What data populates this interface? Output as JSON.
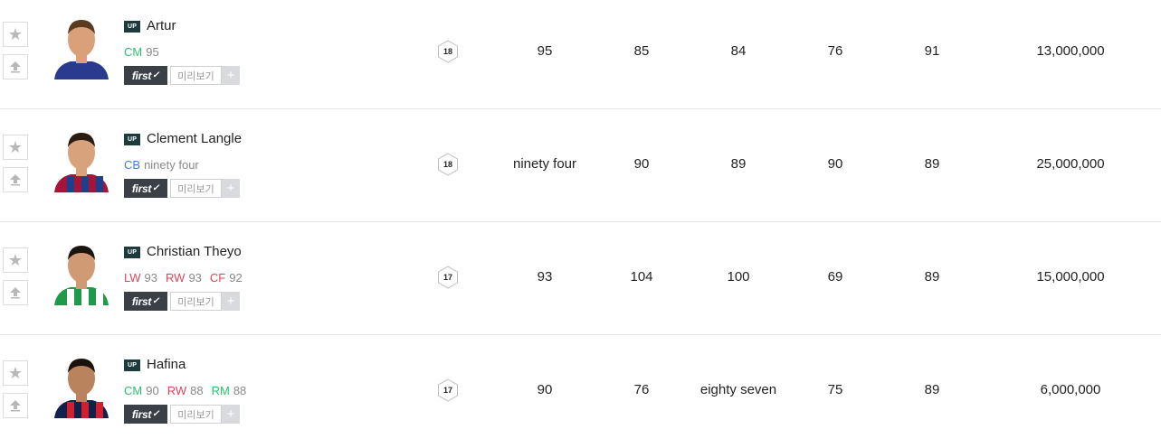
{
  "ui": {
    "up_badge": "UP",
    "first_label": "first",
    "preview_label": "미리보기",
    "plus_label": "+",
    "star_glyph": "★"
  },
  "colors": {
    "cm": "#2cbf6c",
    "cb": "#3f7ee8",
    "lw": "#e0445d",
    "rw": "#e0445d",
    "cf": "#e0445d",
    "rm": "#2cbf6c"
  },
  "players": [
    {
      "name": "Artur",
      "positions": [
        {
          "code": "CM",
          "ovr": "95",
          "color": "#2cbf6c"
        }
      ],
      "season": "18",
      "stats": [
        "95",
        "85",
        "84",
        "76",
        "91"
      ],
      "price": "13,000,000"
    },
    {
      "name": "Clement Langle",
      "positions": [
        {
          "code": "CB",
          "ovr": "ninety four",
          "color": "#3f7ee8"
        }
      ],
      "season": "18",
      "stats": [
        "ninety four",
        "90",
        "89",
        "90",
        "89"
      ],
      "price": "25,000,000"
    },
    {
      "name": "Christian Theyo",
      "positions": [
        {
          "code": "LW",
          "ovr": "93",
          "color": "#e0445d"
        },
        {
          "code": "RW",
          "ovr": "93",
          "color": "#e0445d"
        },
        {
          "code": "CF",
          "ovr": "92",
          "color": "#e0445d"
        }
      ],
      "season": "17",
      "stats": [
        "93",
        "104",
        "100",
        "69",
        "89"
      ],
      "price": "15,000,000"
    },
    {
      "name": "Hafina",
      "positions": [
        {
          "code": "CM",
          "ovr": "90",
          "color": "#2cbf6c"
        },
        {
          "code": "RW",
          "ovr": "88",
          "color": "#e0445d"
        },
        {
          "code": "RM",
          "ovr": "88",
          "color": "#2cbf6c"
        }
      ],
      "season": "17",
      "stats": [
        "90",
        "76",
        "eighty seven",
        "75",
        "89"
      ],
      "price": "6,000,000"
    }
  ]
}
